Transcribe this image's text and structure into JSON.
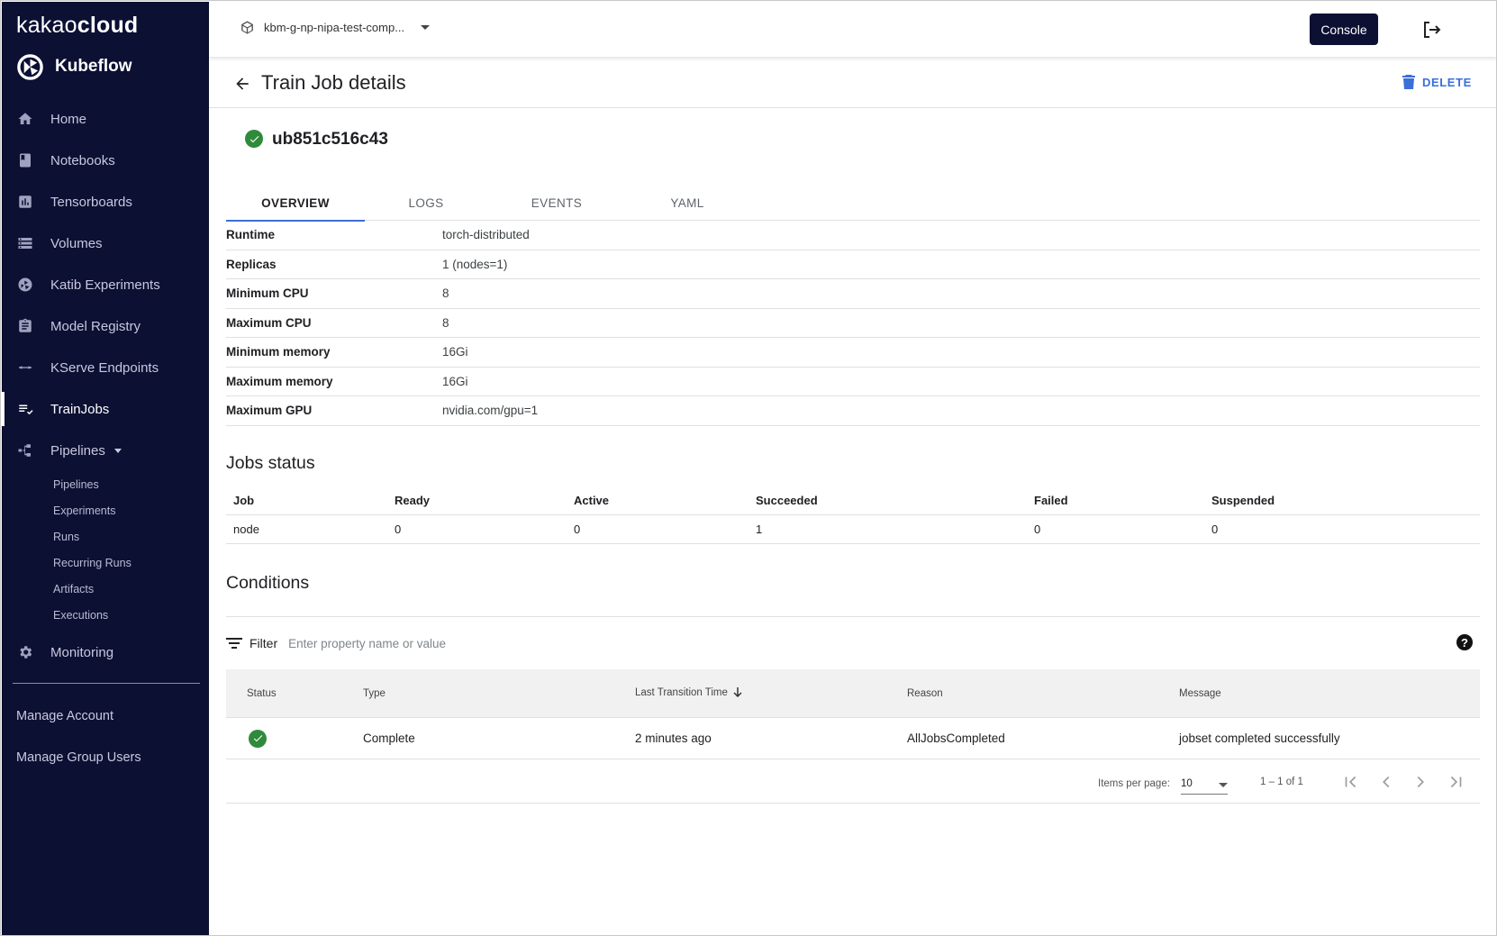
{
  "sidebar": {
    "brand_prefix": "kakao",
    "brand_suffix": "cloud",
    "product": "Kubeflow",
    "items": [
      {
        "label": "Home",
        "icon": "home-icon"
      },
      {
        "label": "Notebooks",
        "icon": "book-icon"
      },
      {
        "label": "Tensorboards",
        "icon": "chart-icon"
      },
      {
        "label": "Volumes",
        "icon": "storage-icon"
      },
      {
        "label": "Katib Experiments",
        "icon": "katib-icon"
      },
      {
        "label": "Model Registry",
        "icon": "clipboard-icon"
      },
      {
        "label": "KServe Endpoints",
        "icon": "arrows-icon"
      },
      {
        "label": "TrainJobs",
        "icon": "checklist-icon",
        "active": true
      },
      {
        "label": "Pipelines",
        "icon": "pipeline-icon"
      },
      {
        "label": "Monitoring",
        "icon": "gear-icon"
      }
    ],
    "pipeline_subitems": [
      "Pipelines",
      "Experiments",
      "Runs",
      "Recurring Runs",
      "Artifacts",
      "Executions"
    ],
    "account_items": [
      "Manage Account",
      "Manage Group Users"
    ]
  },
  "topbar": {
    "namespace": "kbm-g-np-nipa-test-comp...",
    "console_label": "Console"
  },
  "header": {
    "title": "Train Job details",
    "delete_label": "DELETE"
  },
  "job": {
    "name": "ub851c516c43",
    "status": "succeeded"
  },
  "tabs": [
    "OVERVIEW",
    "LOGS",
    "EVENTS",
    "YAML"
  ],
  "overview": [
    {
      "key": "Runtime",
      "value": "torch-distributed"
    },
    {
      "key": "Replicas",
      "value": "1 (nodes=1)"
    },
    {
      "key": "Minimum CPU",
      "value": "8"
    },
    {
      "key": "Maximum CPU",
      "value": "8"
    },
    {
      "key": "Minimum memory",
      "value": "16Gi"
    },
    {
      "key": "Maximum memory",
      "value": "16Gi"
    },
    {
      "key": "Maximum GPU",
      "value": "nvidia.com/gpu=1"
    }
  ],
  "jobs_status": {
    "title": "Jobs status",
    "headers": [
      "Job",
      "Ready",
      "Active",
      "Succeeded",
      "Failed",
      "Suspended"
    ],
    "rows": [
      [
        "node",
        "0",
        "0",
        "1",
        "0",
        "0"
      ]
    ]
  },
  "conditions": {
    "title": "Conditions",
    "filter_label": "Filter",
    "filter_placeholder": "Enter property name or value",
    "headers": [
      "Status",
      "Type",
      "Last Transition Time",
      "Reason",
      "Message"
    ],
    "rows": [
      {
        "status": "complete",
        "type": "Complete",
        "time": "2 minutes ago",
        "reason": "AllJobsCompleted",
        "message": "jobset completed successfully"
      }
    ],
    "items_per_page_label": "Items per page:",
    "items_per_page": "10",
    "range": "1 – 1 of 1"
  },
  "colors": {
    "sidebar_bg": "#0c1033",
    "accent": "#3b6fd9",
    "success": "#2f8a3b"
  }
}
